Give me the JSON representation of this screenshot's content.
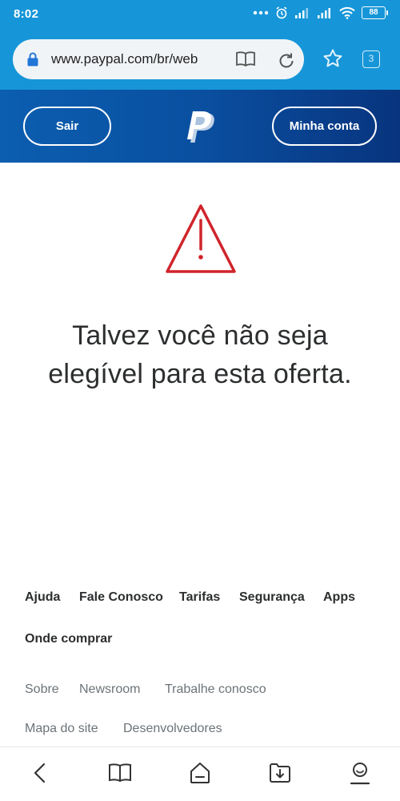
{
  "status_bar": {
    "time": "8:02",
    "battery": "88"
  },
  "browser": {
    "url": "www.paypal.com/br/web",
    "tabs_count": "3"
  },
  "header": {
    "logout_label": "Sair",
    "account_label": "Minha conta",
    "brand_color": "#0a4fa0"
  },
  "main": {
    "message": "Talvez você não seja elegível para esta oferta.",
    "warning_color": "#d0242b"
  },
  "footer": {
    "primary_links": [
      "Ajuda",
      "Fale Conosco",
      "Tarifas",
      "Segurança",
      "Apps",
      "Onde comprar"
    ],
    "secondary_links": [
      "Sobre",
      "Newsroom",
      "Trabalhe conosco",
      "Mapa do site",
      "Desenvolvedores"
    ]
  },
  "icons": [
    "lock-icon",
    "reader-mode-icon",
    "reload-icon",
    "star-icon",
    "back-icon",
    "bookmarks-icon",
    "home-icon",
    "downloads-icon",
    "profile-icon"
  ]
}
